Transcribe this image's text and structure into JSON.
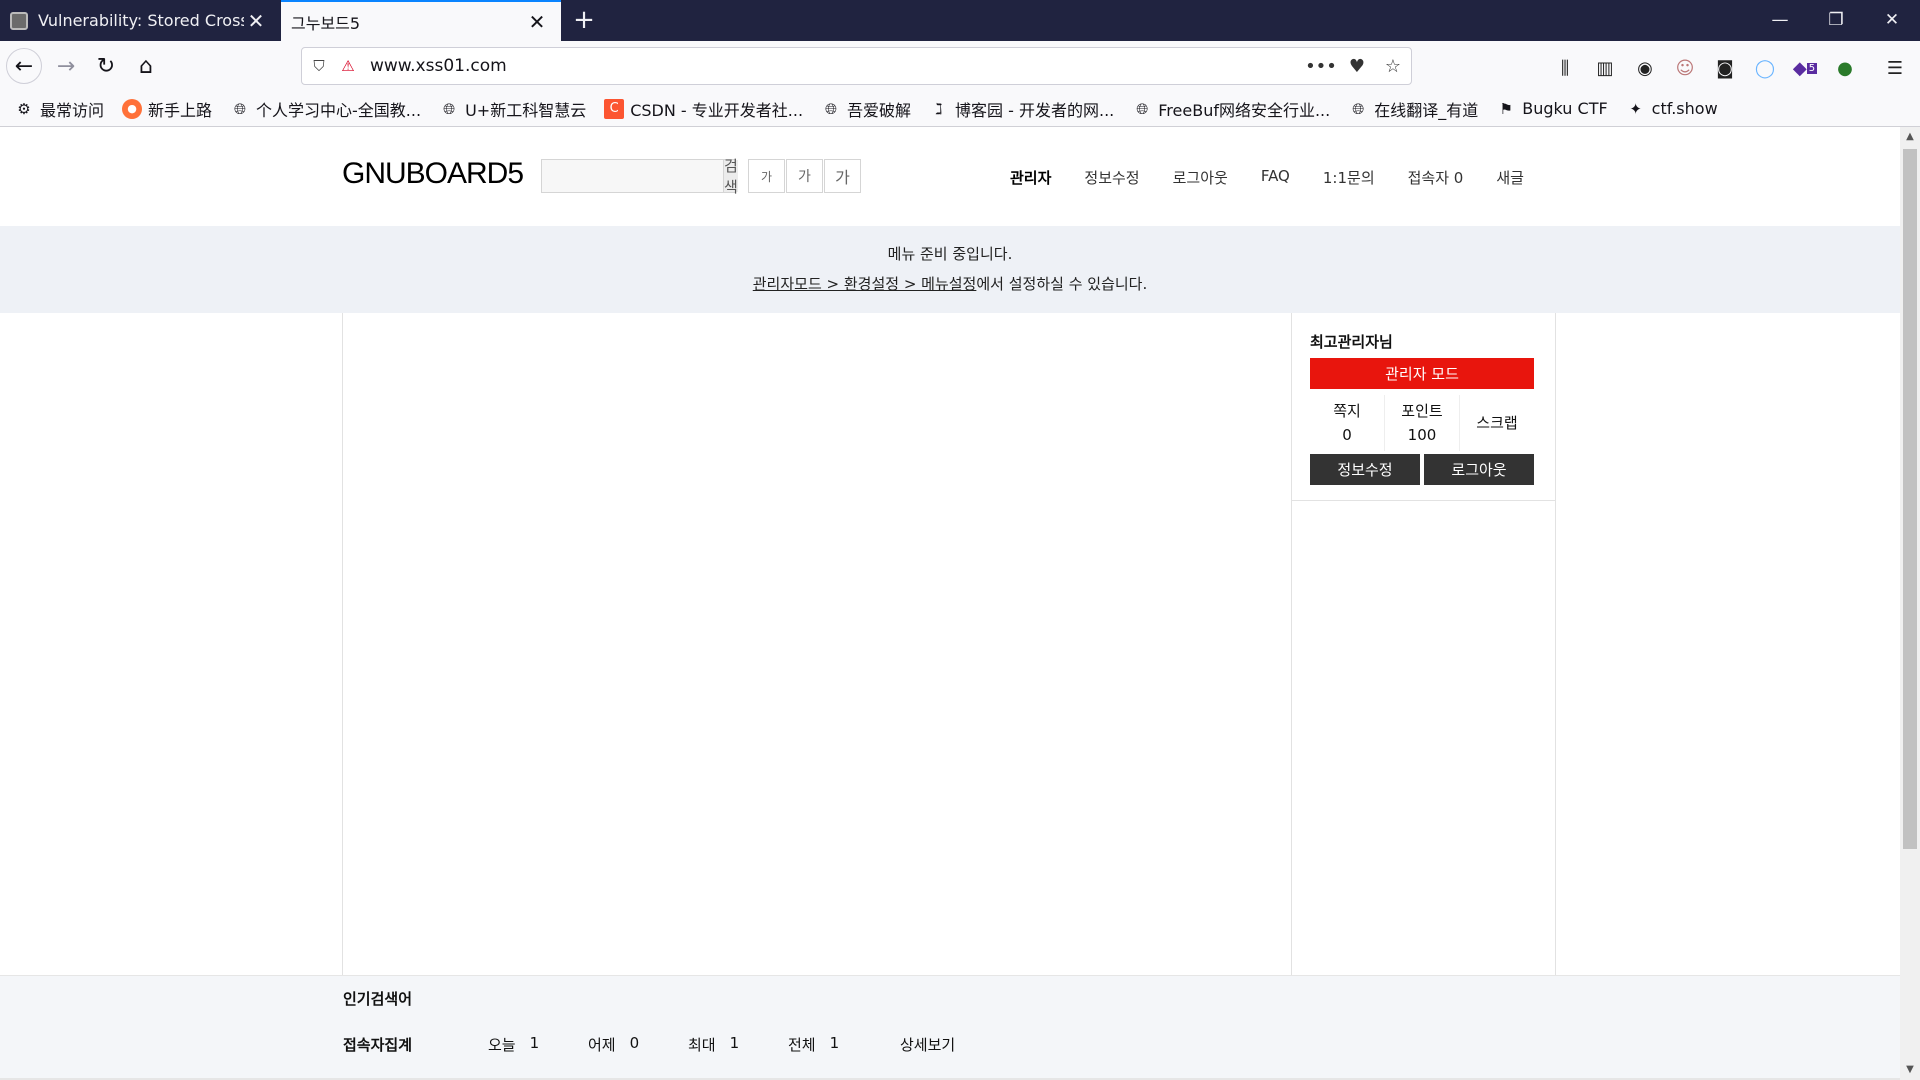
{
  "browser": {
    "tabs": [
      {
        "title": "Vulnerability: Stored Cross Site Scripting (XSS)"
      },
      {
        "title": "그누보드5"
      }
    ],
    "url": "www.xss01.com",
    "bookmarks": [
      {
        "label": "最常访问",
        "icon": "gear-icon"
      },
      {
        "label": "新手上路",
        "icon": "firefox-icon"
      },
      {
        "label": "个人学习中心-全国教...",
        "icon": "globe-icon"
      },
      {
        "label": "U+新工科智慧云",
        "icon": "globe-icon"
      },
      {
        "label": "CSDN - 专业开发者社...",
        "icon": "csdn-icon"
      },
      {
        "label": "吾爱破解",
        "icon": "globe-icon"
      },
      {
        "label": "博客园 - 开发者的网...",
        "icon": "cnblogs-icon"
      },
      {
        "label": "FreeBuf网络安全行业...",
        "icon": "globe-icon"
      },
      {
        "label": "在线翻译_有道",
        "icon": "globe-icon"
      },
      {
        "label": "Bugku CTF",
        "icon": "flag-icon"
      },
      {
        "label": "ctf.show",
        "icon": "runner-icon"
      }
    ],
    "extension_badge": "5"
  },
  "site": {
    "logo": "GNUBOARD5",
    "search_button": "검색",
    "font_buttons": [
      "가",
      "가",
      "가"
    ],
    "nav": [
      "관리자",
      "정보수정",
      "로그아웃",
      "FAQ",
      "1:1문의",
      "접속자 0",
      "새글"
    ]
  },
  "notice": {
    "line1": "메뉴 준비 중입니다.",
    "path1": "관리자모드 > 환경설정 > 메뉴설정",
    "suffix": "에서 설정하실 수 있습니다."
  },
  "outlogin": {
    "nickname": "최고관리자님",
    "admin_mode": "관리자 모드",
    "stats": [
      {
        "label": "쪽지",
        "value": "0"
      },
      {
        "label": "포인트",
        "value": "100"
      },
      {
        "label": "스크랩",
        "value": ""
      }
    ],
    "edit_info": "정보수정",
    "logout": "로그아웃"
  },
  "footer": {
    "popular_title": "인기검색어",
    "visit_title": "접속자집계",
    "visits": [
      {
        "label": "오늘",
        "value": "1"
      },
      {
        "label": "어제",
        "value": "0"
      },
      {
        "label": "최대",
        "value": "1"
      },
      {
        "label": "전체",
        "value": "1"
      }
    ],
    "detail": "상세보기"
  },
  "colors": {
    "tabbar": "#202340",
    "admin_mode_button": "#e8150d",
    "dark_button": "#333333",
    "notice_bg": "#eef1f6"
  }
}
